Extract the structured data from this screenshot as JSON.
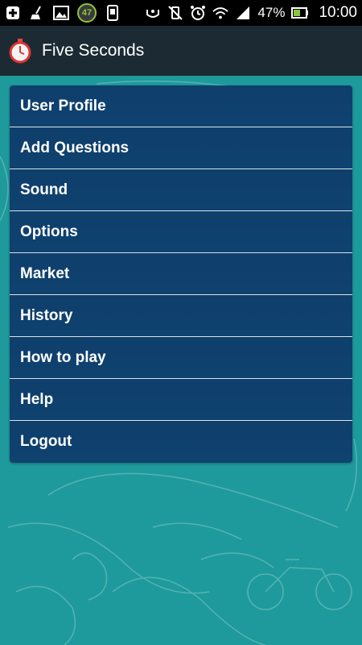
{
  "status_bar": {
    "left_icons": [
      "add-icon",
      "broom-icon",
      "image-icon",
      "notification-badge-icon",
      "phone-icon"
    ],
    "notification_count": "47",
    "right_icons": [
      "gesture-icon",
      "vibrate-off-icon",
      "alarm-icon",
      "wifi-icon",
      "signal-icon"
    ],
    "battery": "47%",
    "time": "10:00"
  },
  "app_bar": {
    "icon": "stopwatch-icon",
    "title": "Five Seconds"
  },
  "menu": {
    "items": [
      {
        "label": "User Profile"
      },
      {
        "label": "Add Questions"
      },
      {
        "label": "Sound"
      },
      {
        "label": "Options"
      },
      {
        "label": "Market"
      },
      {
        "label": "History"
      },
      {
        "label": "How to play"
      },
      {
        "label": "Help"
      },
      {
        "label": "Logout"
      }
    ]
  },
  "colors": {
    "background": "#1f9a9c",
    "app_bar": "#1c2b33",
    "menu_item": "#0f426f",
    "status_bar": "#000000"
  }
}
